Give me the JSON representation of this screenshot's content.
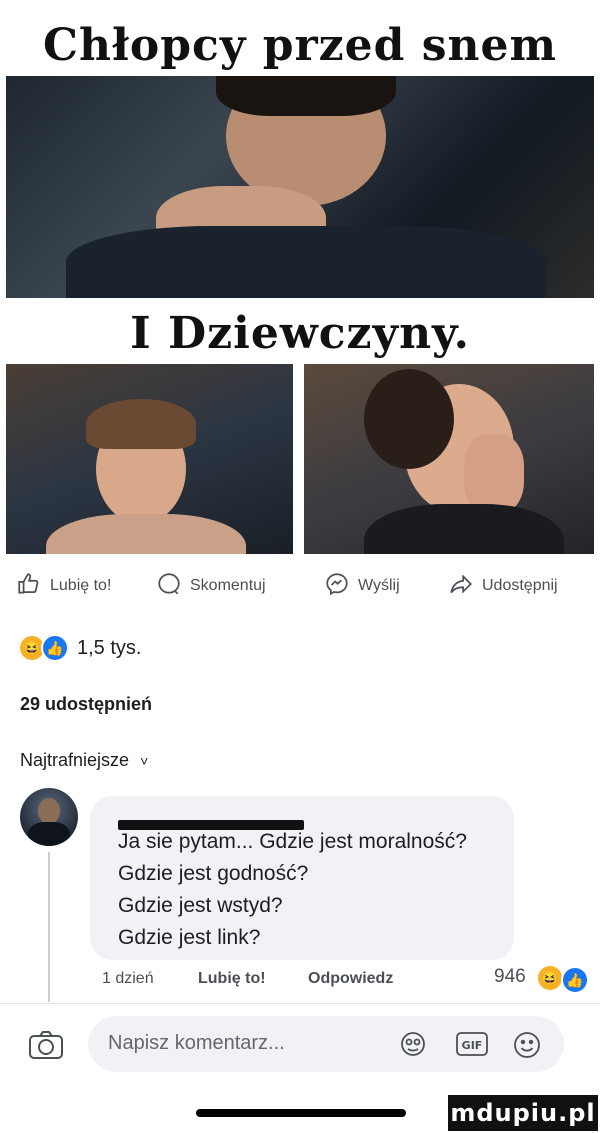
{
  "meme": {
    "title_top": "Chłopcy przed snem",
    "title_middle": "I Dziewczyny."
  },
  "actions": {
    "like": "Lubię to!",
    "comment": "Skomentuj",
    "send": "Wyślij",
    "share": "Udostępnij"
  },
  "reactions": {
    "count": "1,5 tys."
  },
  "shares": "29 udostępnień",
  "sort": {
    "label": "Najtrafniejsze",
    "chevron": "˅"
  },
  "comment": {
    "lines": [
      "Ja sie pytam... Gdzie jest moralność?",
      "Gdzie jest godność?",
      "Gdzie jest wstyd?",
      "Gdzie jest link?"
    ],
    "time": "1 dzień",
    "like": "Lubię to!",
    "reply": "Odpowiedz",
    "reaction_count": "946"
  },
  "composer": {
    "placeholder": "Napisz komentarz..."
  },
  "watermark": "mdupiu.pl",
  "colors": {
    "like_blue": "#1877f2",
    "haha_yellow": "#f7b125",
    "bubble_bg": "#f0f2f5"
  }
}
